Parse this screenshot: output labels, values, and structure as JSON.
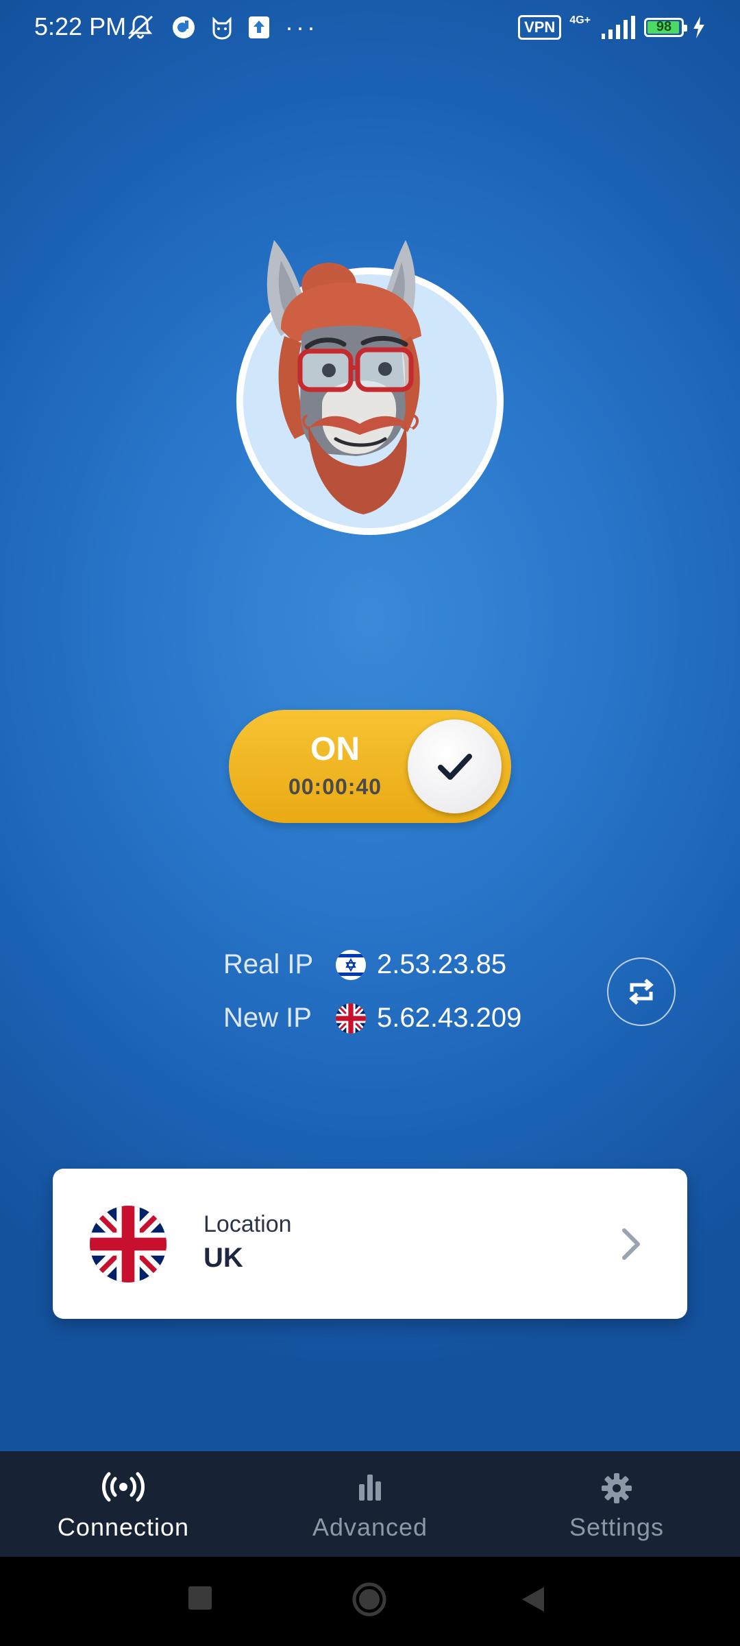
{
  "status_bar": {
    "time": "5:22 PM",
    "more": "···",
    "vpn": "VPN",
    "network": "4G+",
    "battery": "98",
    "icons": [
      "mute-icon",
      "app-notification-icon",
      "cat-app-icon",
      "upload-icon",
      "signal-icon",
      "charging-icon"
    ]
  },
  "toggle": {
    "state": "ON",
    "timer": "00:00:40",
    "colors": {
      "track": "#f3b822",
      "knob": "#f2f2f4",
      "check": "#172335"
    }
  },
  "ip": {
    "real_label": "Real IP",
    "real_value": "2.53.23.85",
    "real_flag": "israel-flag-icon",
    "new_label": "New IP",
    "new_value": "5.62.43.209",
    "new_flag": "uk-flag-icon"
  },
  "location": {
    "title": "Location",
    "value": "UK",
    "flag": "uk-flag-icon"
  },
  "bottom_nav": {
    "items": [
      {
        "label": "Connection",
        "icon": "broadcast-icon",
        "active": true
      },
      {
        "label": "Advanced",
        "icon": "bar-chart-icon",
        "active": false
      },
      {
        "label": "Settings",
        "icon": "gear-icon",
        "active": false
      }
    ]
  },
  "colors": {
    "background": "#2a78cc",
    "nav_background": "#172335",
    "accent": "#f3b822"
  }
}
